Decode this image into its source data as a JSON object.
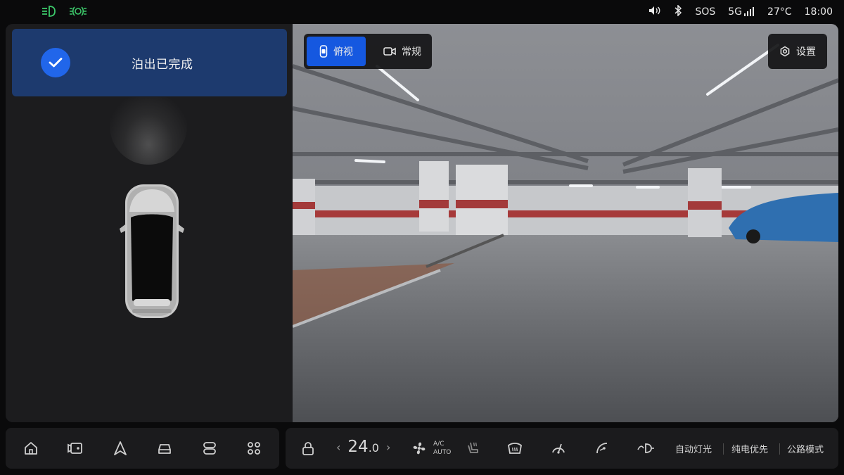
{
  "status_bar": {
    "left_icons": [
      "low-beam-icon",
      "parking-light-icon"
    ],
    "sos": "SOS",
    "network": "5G",
    "temperature": "27°C",
    "time": "18:00"
  },
  "parking": {
    "status_text": "泊出已完成"
  },
  "camera": {
    "view_top": "俯视",
    "view_normal": "常规",
    "settings": "设置"
  },
  "dock": {
    "left_icons": [
      "home-icon",
      "dashcam-icon",
      "navigation-icon",
      "car-icon",
      "toggle-icon",
      "apps-grid-icon"
    ],
    "temp_value": "24",
    "temp_decimal": ".0",
    "ac_line1": "A/C",
    "ac_line2": "AUTO",
    "auto_light": "自动灯光",
    "ev_priority": "纯电优先",
    "road_mode": "公路模式"
  },
  "colors": {
    "accent_blue": "#1558e0",
    "banner_blue": "#1d3a6e",
    "indicator_green": "#3cc86a"
  }
}
